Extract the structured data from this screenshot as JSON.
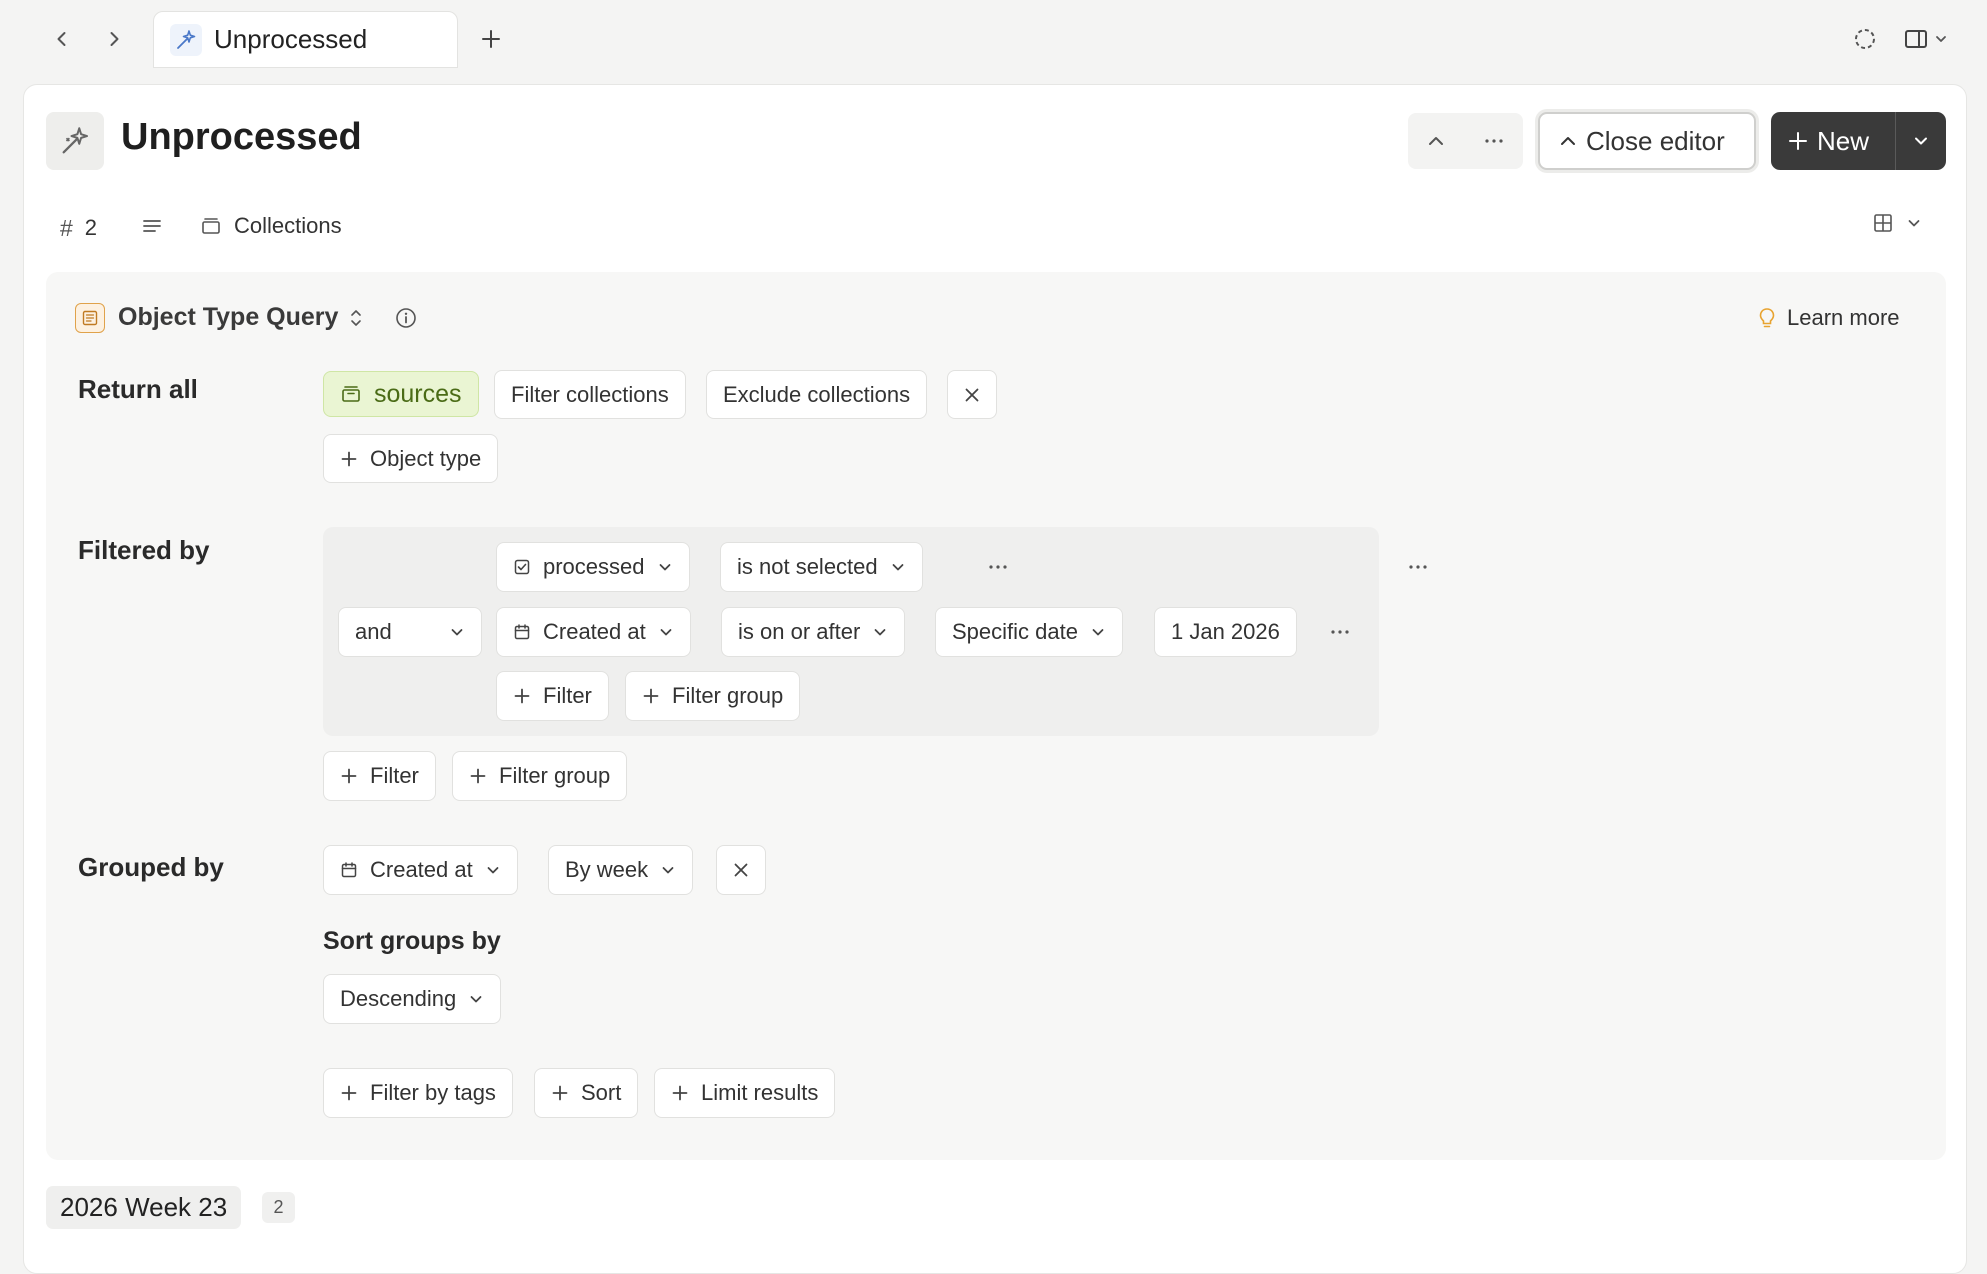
{
  "tab": {
    "title": "Unprocessed"
  },
  "header": {
    "title": "Unprocessed",
    "close_editor_label": "Close editor",
    "new_label": "New"
  },
  "meta": {
    "count": "2",
    "collections_label": "Collections"
  },
  "query": {
    "type_label": "Object Type Query",
    "learn_more": "Learn more",
    "return_all_label": "Return all",
    "source_chip": "sources",
    "filter_collections": "Filter collections",
    "exclude_collections": "Exclude collections",
    "add_object_type": "Object type",
    "filtered_by_label": "Filtered by",
    "filters": [
      {
        "property": "processed",
        "operator": "is not selected"
      },
      {
        "conjunction": "and",
        "property": "Created at",
        "operator": "is on or after",
        "date_mode": "Specific date",
        "value": "1 Jan 2026"
      }
    ],
    "inner_add_filter": "Filter",
    "inner_add_filter_group": "Filter group",
    "outer_add_filter": "Filter",
    "outer_add_filter_group": "Filter group",
    "grouped_by_label": "Grouped by",
    "group_property": "Created at",
    "group_interval": "By week",
    "sort_groups_by_label": "Sort groups by",
    "sort_order": "Descending",
    "add_filter_by_tags": "Filter by tags",
    "add_sort": "Sort",
    "add_limit_results": "Limit results"
  },
  "results": {
    "group_title": "2026 Week 23",
    "group_count": "2"
  },
  "colors": {
    "new_button_bg": "#3a3a3a",
    "source_chip_bg": "#eaf5d3",
    "source_chip_text": "#4a6b16",
    "query_panel_bg": "#f7f7f6",
    "filter_group_bg": "#efefee",
    "type_icon_accent": "#e0a24a",
    "learn_more_icon": "#e8a330"
  }
}
